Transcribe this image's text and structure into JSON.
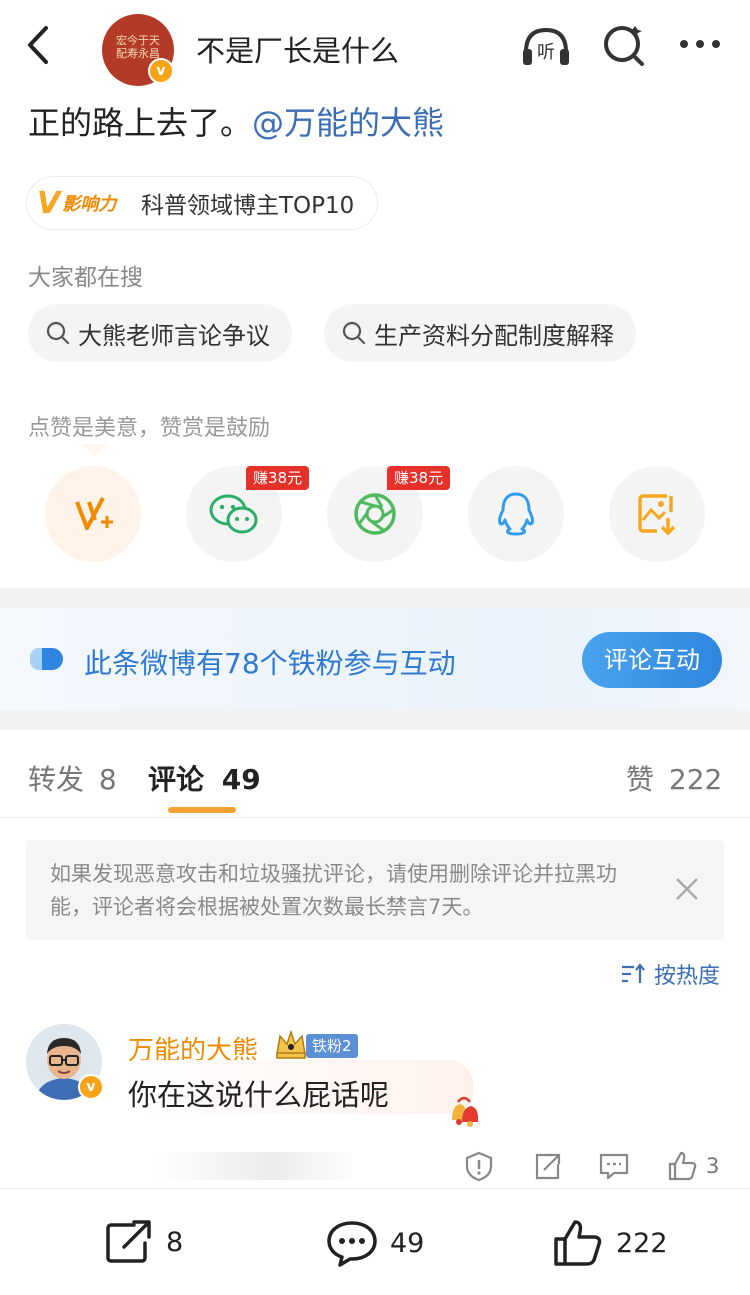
{
  "header": {
    "title": "不是厂长是什么",
    "avatar_text": "宏今于天 配寿永昌",
    "listen_label": "听"
  },
  "post": {
    "text": "正的路上去了。",
    "mention": "@万能的大熊"
  },
  "influence": {
    "tag": "影响力",
    "rank": "科普领域博主TOP10"
  },
  "search": {
    "label": "大家都在搜",
    "chips": [
      "大熊老师言论争议",
      "生产资料分配制度解释"
    ]
  },
  "share": {
    "label": "点赞是美意，赞赏是鼓励",
    "earn_badge": "赚38元",
    "icons": [
      "v-plus-icon",
      "wechat-icon",
      "moments-icon",
      "qq-icon",
      "save-image-icon"
    ]
  },
  "fans_banner": {
    "text": "此条微博有78个铁粉参与互动",
    "button": "评论互动"
  },
  "tabs": {
    "repost_label": "转发",
    "repost_count": "8",
    "comment_label": "评论",
    "comment_count": "49",
    "like_label": "赞",
    "like_count": "222"
  },
  "notice": {
    "text": "如果发现恶意攻击和垃圾骚扰评论，请使用删除评论并拉黑功能，评论者将会根据被处置次数最长禁言7天。"
  },
  "sort": {
    "label": "按热度"
  },
  "comment": {
    "author": "万能的大熊",
    "fan_badge": "铁粉2",
    "text": "你在这说什么屁话呢",
    "likes": "3"
  },
  "bottom_bar": {
    "repost": "8",
    "comment": "49",
    "like": "222"
  },
  "colors": {
    "accent_orange": "#f7a234",
    "link_blue": "#3b6eb5",
    "badge_red": "#e5312a"
  }
}
